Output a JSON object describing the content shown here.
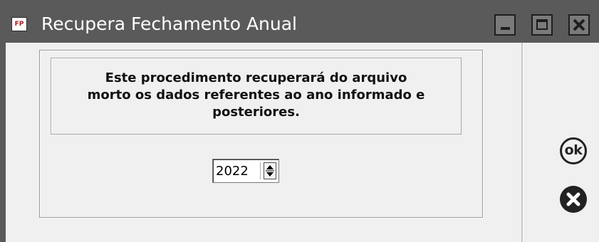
{
  "window": {
    "app_icon_label": "FP",
    "title": "Recupera Fechamento Anual"
  },
  "message": {
    "text": "Este procedimento recuperará do arquivo\nmorto os dados referentes ao ano informado e\nposteriores."
  },
  "year_spinner": {
    "value": "2022"
  },
  "actions": {
    "ok_label": "ok"
  },
  "colors": {
    "titlebar": "#5a5a5a",
    "window_background": "#f0f0f0",
    "button_dark": "#222222"
  },
  "icons": {
    "app": "fp-app-icon",
    "minimize": "minimize-icon",
    "maximize": "maximize-icon",
    "close": "close-icon",
    "spin": "spin-up-down-icon",
    "cancel": "cancel-x-circle-icon"
  }
}
